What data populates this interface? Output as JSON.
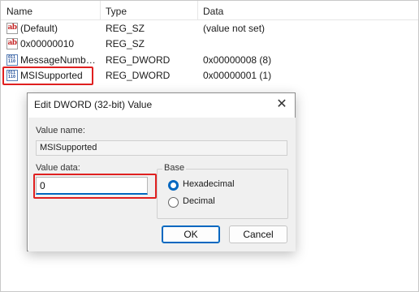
{
  "columns": {
    "name": "Name",
    "type": "Type",
    "data": "Data"
  },
  "rows": [
    {
      "icon": "string-value-icon",
      "glyph": "ab",
      "name": "(Default)",
      "type": "REG_SZ",
      "data": "(value not set)"
    },
    {
      "icon": "string-value-icon",
      "glyph": "ab",
      "name": "0x00000010",
      "type": "REG_SZ",
      "data": ""
    },
    {
      "icon": "dword-value-icon",
      "glyph": "011 110",
      "name": "MessageNumberLimit",
      "type": "REG_DWORD",
      "data": "0x00000008 (8)"
    },
    {
      "icon": "dword-value-icon",
      "glyph": "011 110",
      "name": "MSISupported",
      "type": "REG_DWORD",
      "data": "0x00000001 (1)"
    }
  ],
  "dialog": {
    "title": "Edit DWORD (32-bit) Value",
    "close_glyph": "✕",
    "value_name_label": "Value name:",
    "value_name": "MSISupported",
    "value_data_label": "Value data:",
    "value_data": "0",
    "base_label": "Base",
    "radio_hex": "Hexadecimal",
    "radio_dec": "Decimal",
    "base_selected": "Hexadecimal",
    "ok_label": "OK",
    "cancel_label": "Cancel"
  },
  "colors": {
    "accent": "#0067c0",
    "highlight": "#e02020"
  }
}
